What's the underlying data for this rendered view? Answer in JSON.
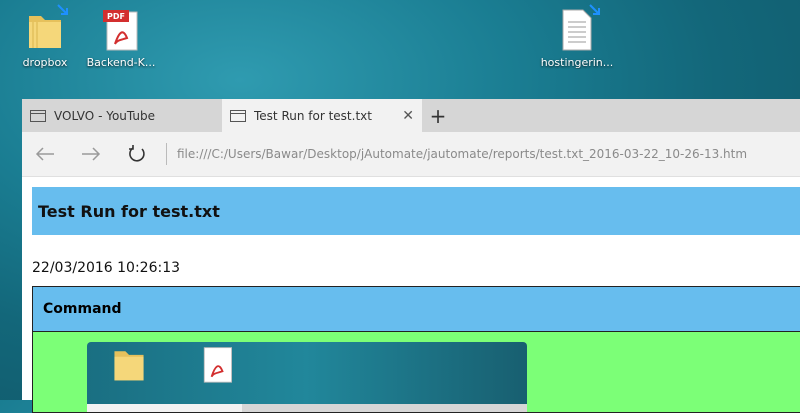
{
  "desktop": {
    "icons": [
      {
        "label": "dropbox",
        "icon": "folder-icon"
      },
      {
        "label": "Backend-K...",
        "icon": "pdf-icon"
      },
      {
        "label": "hostingerin...",
        "icon": "document-icon"
      }
    ]
  },
  "browser": {
    "tabs": [
      {
        "title": "VOLVO - YouTube",
        "active": false
      },
      {
        "title": "Test Run for test.txt",
        "active": true
      }
    ],
    "new_tab_label": "+",
    "close_label": "✕",
    "address": "file:///C:/Users/Bawar/Desktop/jAutomate/jautomate/reports/test.txt_2016-03-22_10-26-13.htm"
  },
  "page": {
    "title": "Test Run for test.txt",
    "timestamp": "22/03/2016 10:26:13",
    "table": {
      "header": "Command"
    }
  },
  "colors": {
    "header_blue": "#67bdee",
    "row_green": "#7cff77",
    "tabbar": "#d6d6d6"
  }
}
